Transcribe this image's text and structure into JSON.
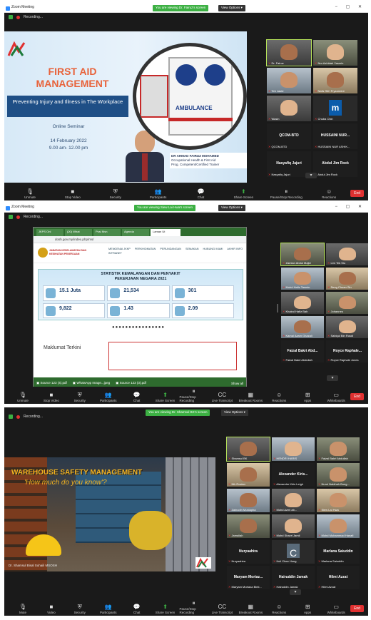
{
  "s1": {
    "title": "Zoom Meeting",
    "share_banner": "You are viewing Dr. Fairuz's screen",
    "view_options": "View Options ▾",
    "recording": "Recording...",
    "slide": {
      "title_line1": "FIRST AID",
      "title_line2": "MANAGEMENT",
      "subtitle": "Preventing Injury and Illness in The Workplace",
      "type": "Online Seminar",
      "date": "14 February 2022",
      "time": "9.00 am- 12.00 pm",
      "ambulance_text": "AMBULANCE",
      "speaker_name": "DR AHMAD FAIRUZ MOHAMED",
      "speaker_role1": "Occupational Health & First Aid",
      "speaker_role2": "Prog. Competent/Certified Trainer"
    },
    "participants": [
      {
        "name": "Dr. Fairuz"
      },
      {
        "name": "Nor Azhidah Yasmin"
      },
      {
        "name": "Teh Jasid"
      },
      {
        "name": "Nafiz Sifri Fryzarmint"
      },
      {
        "name": "Wasin"
      },
      {
        "name": "Chuba Chin"
      },
      {
        "center": "QCOM-BTD",
        "name": "QCOM-BTD"
      },
      {
        "center": "HUSSAINI NUR...",
        "name": "HUSSAINI NUR ASHIK..."
      },
      {
        "center": "Nasyafiq Jajuri",
        "name": "Nasyafiq Jajuri"
      },
      {
        "center": "Abdul Jim Rock",
        "name": "Abdul Jim Rock"
      }
    ],
    "toolbar": [
      "Unmute",
      "Stop Video",
      "Security",
      "Participants",
      "Chat",
      "Share Screen",
      "Pause/Stop Recording",
      "Reactions"
    ],
    "participant_count": "20",
    "end": "End"
  },
  "s2": {
    "title": "Zoom Meeting",
    "share_banner": "You are viewing Siew Lai Hwa's screen",
    "view_options": "View Options ▾",
    "recording": "Recording...",
    "browser": {
      "tabs": [
        "JKPS Onl",
        "(20) What",
        "Pusi Msn",
        "Agenda",
        "Laman Ut"
      ],
      "url": "dosh.gov.my/index.php/ms/",
      "agency": "JABATAN KESELAMATAN DAN KESIHATAN PEKERJAAN",
      "nav": [
        "MENGENAI JKKP",
        "PERKHIDMATAN",
        "PERUNDANGAN",
        "SEMAKAN",
        "HUBUNGI KAMI",
        "AKHIR INFO",
        "INTRANET"
      ],
      "banner_title1": "STATISTIK KEMALANGAN DAN PENYAKIT",
      "banner_title2": "PEKERJAAN NEGARA 2021",
      "stats": [
        "15.1 Juta",
        "21,534",
        "301",
        "9,822",
        "1.43",
        "2.09"
      ],
      "footer": "Maklumat Terkini",
      "downloads": [
        "Source 123 (4).pdf",
        "WhatsApp Image...jpeg",
        "Source 123 (3).pdf"
      ],
      "show_all": "Show all"
    },
    "participants": [
      {
        "name": "Zamian Abdul Majid"
      },
      {
        "name": "Lim Tek Siu"
      },
      {
        "name": "Mohd Hafiz Tasmin"
      },
      {
        "name": "Seng Chuan Sin"
      },
      {
        "name": "Khairul Hafiz Bah"
      },
      {
        "name": "Johannes"
      },
      {
        "name": "Kamal Azam Ghazali"
      },
      {
        "name": "Sabiqul Bin Rusdi"
      },
      {
        "center": "Faizal Bakri Abd...",
        "name": "Faizal Bakri Abdullah"
      },
      {
        "center": "Royce Raphale...",
        "name": "Royce Raphale Jones"
      }
    ],
    "toolbar": [
      "Unmute",
      "Stop Video",
      "Security",
      "Participants",
      "Chat",
      "Share Screen",
      "Pause/Stop Recording",
      "Live Transcript",
      "Breakout Rooms",
      "Reactions",
      "Apps",
      "Whiteboards"
    ],
    "end": "End"
  },
  "s3": {
    "share_banner": "You are viewing Dr. Shamsul BK's screen",
    "view_options": "View Options ▾",
    "recording": "Recording...",
    "slide": {
      "title": "WAREHOUSE SAFETY MANAGEMENT",
      "subtitle": "'How much do you know'?",
      "presenter": "Dr. Shamsul Bisal Suhaili MSOSH"
    },
    "participants": [
      {
        "name": "Shamsul BK"
      },
      {
        "name": "HENDRI HARIS"
      },
      {
        "name": "Faizal Bakri Abdullah"
      },
      {
        "name": "Nik Roslan"
      },
      {
        "center": "Alexander Kiris...",
        "name": "Alexander Kiris Leigh"
      },
      {
        "name": "Nurul Nabihah Bung..."
      },
      {
        "name": "Zainudin Mustapha"
      },
      {
        "name": "Mohd Azmi ab..."
      },
      {
        "name": "Siew Lai Hwa"
      },
      {
        "name": "Jamaliah"
      },
      {
        "name": "Mohd Shazri Jamil"
      },
      {
        "name": "Mohd Muhammad Hanafi"
      },
      {
        "center": "Nuryaahira",
        "name": "Nuryaahira"
      },
      {
        "name": "Kuli Chee Hong"
      },
      {
        "center": "Marlana Saiuddin",
        "name": "Marlana Saiuddin"
      },
      {
        "center": "Maryam Mortaz...",
        "name": "Maryam Mortaza Binti..."
      },
      {
        "center": "Hairuddin Jamak",
        "name": "Hairuddin Jamak"
      },
      {
        "center": "Hilmi Azzat",
        "name": "Hilmi Azzat"
      }
    ],
    "toolbar": [
      "Mute",
      "Video",
      "Security",
      "Participants",
      "Chat",
      "Share Screen",
      "Pause/Stop Recording",
      "Live Transcript",
      "Breakout Rooms",
      "Reactions",
      "Apps",
      "Whiteboards"
    ],
    "participant_count": "57",
    "end": "End"
  }
}
